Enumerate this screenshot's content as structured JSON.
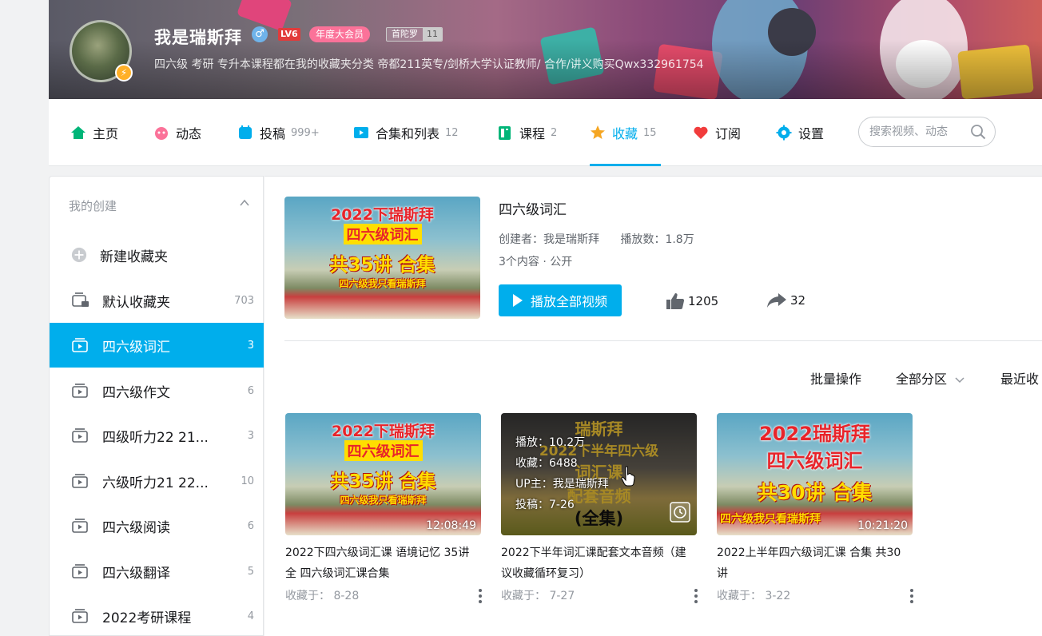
{
  "user": {
    "name": "我是瑞斯拜",
    "level": "LV6",
    "vip": "年度大会员",
    "medal_name": "首陀罗",
    "medal_level": "11",
    "sign": "四六级 考研 专升本课程都在我的收藏夹分类 帝都211英专/剑桥大学认证教师/ 合作/讲义购买Qwx332961754"
  },
  "nav": {
    "tabs": [
      {
        "label": "主页",
        "count": ""
      },
      {
        "label": "动态",
        "count": ""
      },
      {
        "label": "投稿",
        "count": "999+"
      },
      {
        "label": "合集和列表",
        "count": "12"
      },
      {
        "label": "课程",
        "count": "2"
      },
      {
        "label": "收藏",
        "count": "15"
      },
      {
        "label": "订阅",
        "count": ""
      },
      {
        "label": "设置",
        "count": ""
      }
    ],
    "search_placeholder": "搜索视频、动态"
  },
  "sidebar": {
    "heading": "我的创建",
    "new_folder": "新建收藏夹",
    "items": [
      {
        "label": "默认收藏夹",
        "count": "703"
      },
      {
        "label": "四六级词汇",
        "count": "3"
      },
      {
        "label": "四六级作文",
        "count": "6"
      },
      {
        "label": "四级听力22 21...",
        "count": "3"
      },
      {
        "label": "六级听力21 22...",
        "count": "10"
      },
      {
        "label": "四六级阅读",
        "count": "6"
      },
      {
        "label": "四六级翻译",
        "count": "5"
      },
      {
        "label": "2022考研课程",
        "count": "4"
      }
    ]
  },
  "folder": {
    "title": "四六级词汇",
    "creator": "创建者：我是瑞斯拜",
    "plays": "播放数：1.8万",
    "content": "3个内容 · 公开",
    "play_all": "播放全部视频",
    "likes": "1205",
    "shares": "32",
    "cover_lines": [
      "2022下瑞斯拜",
      "四六级词汇",
      "共35讲 合集",
      "四六级我只看瑞斯拜"
    ]
  },
  "toolbar": {
    "batch": "批量操作",
    "zone": "全部分区",
    "sort": "最近收"
  },
  "videos": [
    {
      "title": "2022下四六级词汇课 语境记忆 35讲 全 四六级词汇课合集",
      "date": "收藏于： 8-28",
      "duration": "12:08:49",
      "cover_lines": [
        "2022下瑞斯拜",
        "四六级词汇",
        "共35讲 合集",
        "四六级我只看瑞斯拜"
      ]
    },
    {
      "title": "2022下半年词汇课配套文本音频（建议收藏循环复习）",
      "date": "收藏于： 7-27",
      "duration": "",
      "cover_lines": [
        "瑞斯拜",
        "2022下半年四六级",
        "词汇课",
        "配套音频",
        "(全集)"
      ],
      "hover": {
        "plays": "播放：10.2万",
        "favs": "收藏：6488",
        "up": "UP主：我是瑞斯拜",
        "posted": "投稿：7-26"
      }
    },
    {
      "title": "2022上半年四六级词汇课 合集 共30讲",
      "date": "收藏于： 3-22",
      "duration": "10:21:20",
      "cover_lines": [
        "2022瑞斯拜",
        "四六级词汇",
        "共30讲 合集",
        "四六级我只看瑞斯拜"
      ]
    }
  ],
  "colors": {
    "accent": "#00aeec",
    "vip_pink": "#fb7299",
    "level_red": "#e23b3b"
  }
}
